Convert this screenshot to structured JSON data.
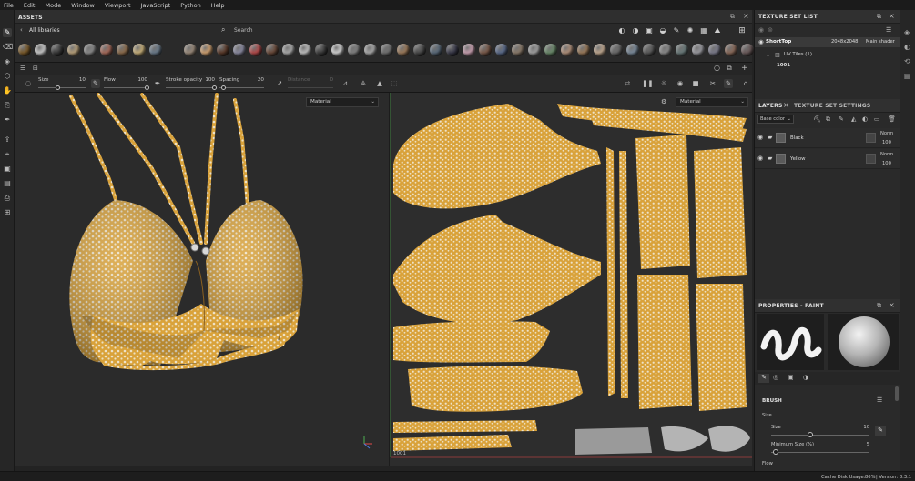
{
  "menu": [
    "File",
    "Edit",
    "Mode",
    "Window",
    "Viewport",
    "JavaScript",
    "Python",
    "Help"
  ],
  "assets": {
    "title": "ASSETS",
    "library": "All libraries",
    "search_placeholder": "Search",
    "materials": [
      "#7a5a2a",
      "#c9c9c9",
      "#3a3a3a",
      "#b7a07a",
      "#8a8a8a",
      "#a66a5a",
      "#8c6c4c",
      "#c8b07a",
      "#6a7a8a",
      "#9a8a7a",
      "#cfa070",
      "#5a3a2a",
      "#8a8aa0",
      "#b44a4a",
      "#6a4a3a",
      "#aaaaaa",
      "#c0c0c0",
      "#3c3c3c",
      "#d2d2d2",
      "#808080",
      "#a8a8a8",
      "#707070",
      "#9c7a5a",
      "#4a4a4a",
      "#5a6a7a",
      "#3a3a4a",
      "#c8a0b0",
      "#7a5a4a",
      "#5a6a8a",
      "#8a7a6a",
      "#a0a0a0",
      "#6a8a6a",
      "#b0907a",
      "#9a7a5a",
      "#c0a890",
      "#6a6a6a",
      "#7a8a9a",
      "#5a5a5a",
      "#8a8a8a",
      "#6a7a7a",
      "#9a9aa0",
      "#7a7a8a",
      "#8a6a5a",
      "#6a5a5a",
      "#909090"
    ]
  },
  "tool": {
    "size_label": "Size",
    "size_value": "10",
    "size_frac": 0.42,
    "flow_label": "Flow",
    "flow_value": "100",
    "flow_frac": 1.0,
    "opacity_label": "Stroke opacity",
    "opacity_value": "100",
    "opacity_frac": 1.0,
    "spacing_label": "Spacing",
    "spacing_value": "20",
    "spacing_frac": 0.1,
    "distance_label": "Distance",
    "distance_value": "0"
  },
  "viewport": {
    "left_mode": "Material",
    "right_mode": "Material",
    "uv_tile": "1001"
  },
  "texture_set_list": {
    "title": "TEXTURE SET LIST",
    "name": "ShortTop",
    "resolution": "2048x2048",
    "shader": "Main shader",
    "uv_tiles": "UV Tiles (1)",
    "tile": "1001"
  },
  "layers": {
    "tab_layers": "LAYERS",
    "tab_settings": "TEXTURE SET SETTINGS",
    "channel": "Base color",
    "items": [
      {
        "name": "Black",
        "blend": "Norm",
        "opacity": "100"
      },
      {
        "name": "Yellow",
        "blend": "Norm",
        "opacity": "100"
      }
    ]
  },
  "properties": {
    "title": "PROPERTIES - PAINT",
    "section": "BRUSH",
    "size_group": "Size",
    "size_label": "Size",
    "size_value": "10",
    "size_frac": 0.4,
    "minsize_label": "Minimum Size (%)",
    "minsize_value": "5",
    "minsize_frac": 0.05,
    "flow_label": "Flow"
  },
  "status": {
    "cache": "Cache Disk Usage:",
    "cache_value": "86%",
    "version_label": "| Version: 8.3.1"
  }
}
